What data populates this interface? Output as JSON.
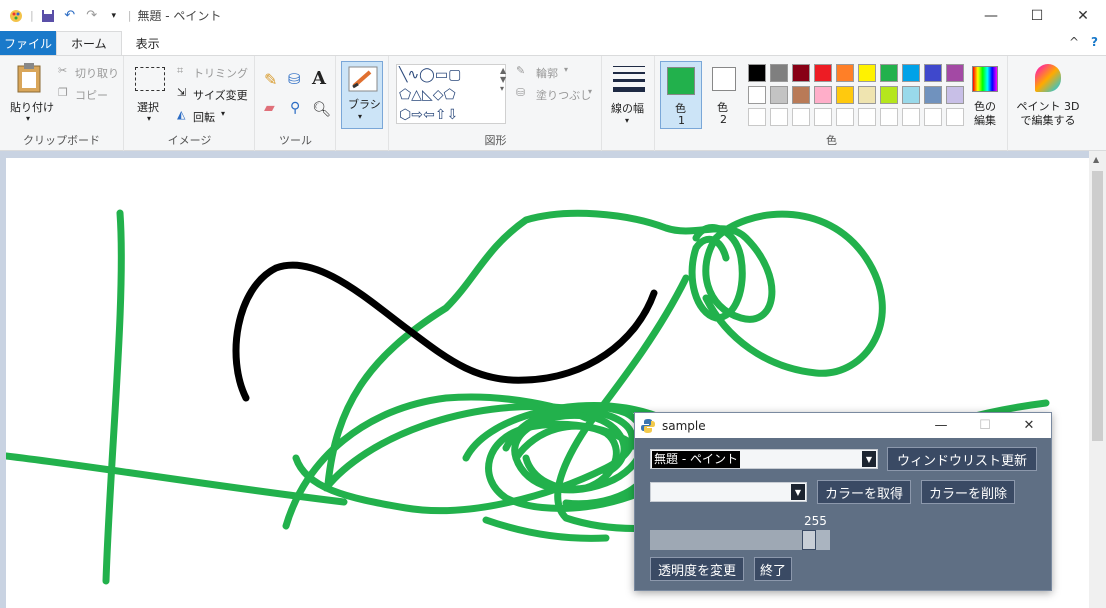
{
  "window": {
    "title": "無題 - ペイント",
    "minimize": "—",
    "maximize": "☐",
    "close": "✕"
  },
  "menu": {
    "file": "ファイル",
    "home": "ホーム",
    "view": "表示",
    "help": "?",
    "collapse": "^"
  },
  "ribbon": {
    "clipboard": {
      "paste": "貼り付け",
      "cut": "切り取り",
      "copy": "コピー",
      "label": "クリップボード"
    },
    "image": {
      "select": "選択",
      "crop": "トリミング",
      "resize": "サイズ変更",
      "rotate": "回転",
      "label": "イメージ"
    },
    "tools": {
      "label": "ツール"
    },
    "brush": {
      "label": "ブラシ"
    },
    "shapes": {
      "outline": "輪郭",
      "fill": "塗りつぶし",
      "label": "図形"
    },
    "size": {
      "label": "線の幅"
    },
    "colors": {
      "color1": "色",
      "color1_num": "1",
      "color2": "色",
      "color2_num": "2",
      "edit": "色の編集",
      "label": "色",
      "active_color": "#22b14c",
      "palette_row1": [
        "#000000",
        "#7f7f7f",
        "#880015",
        "#ed1c24",
        "#ff7f27",
        "#fff200",
        "#22b14c",
        "#00a2e8",
        "#3f48cc",
        "#a349a4"
      ],
      "palette_row2": [
        "#ffffff",
        "#c3c3c3",
        "#b97a57",
        "#ffaec9",
        "#ffc90e",
        "#efe4b0",
        "#b5e61d",
        "#99d9ea",
        "#7092be",
        "#c8bfe7"
      ]
    },
    "paint3d": {
      "label": "ペイント 3D で編集する"
    }
  },
  "dialog": {
    "title": "sample",
    "window_combo": "無題 - ペイント",
    "refresh_button": "ウィンドウリスト更新",
    "color_combo": "",
    "get_color_button": "カラーを取得",
    "delete_color_button": "カラーを削除",
    "slider_value": "255",
    "slider_fraction": 1.0,
    "change_opacity_button": "透明度を変更",
    "exit_button": "終了"
  }
}
